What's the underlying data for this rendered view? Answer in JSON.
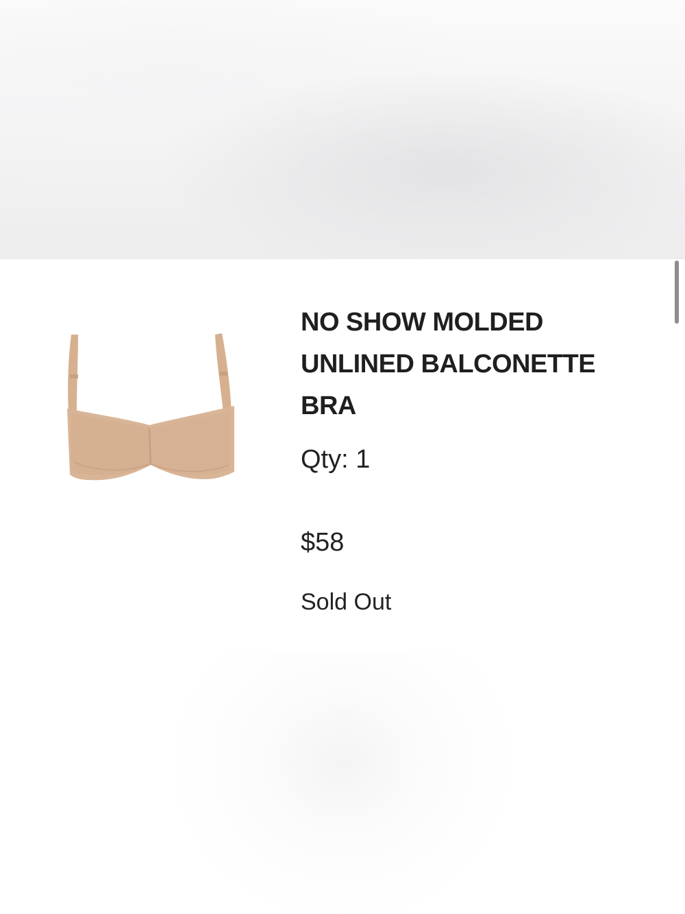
{
  "product": {
    "name": "NO SHOW MOLDED UNLINED BALCONETTE BRA",
    "image_icon": "bra-product-image",
    "quantity_text": "Qty: 1",
    "price": "$58",
    "status": "Sold Out"
  },
  "colors": {
    "text": "#1f1f1f",
    "product_tone": "#d9b597",
    "scrollbar": "#8e8e90"
  }
}
